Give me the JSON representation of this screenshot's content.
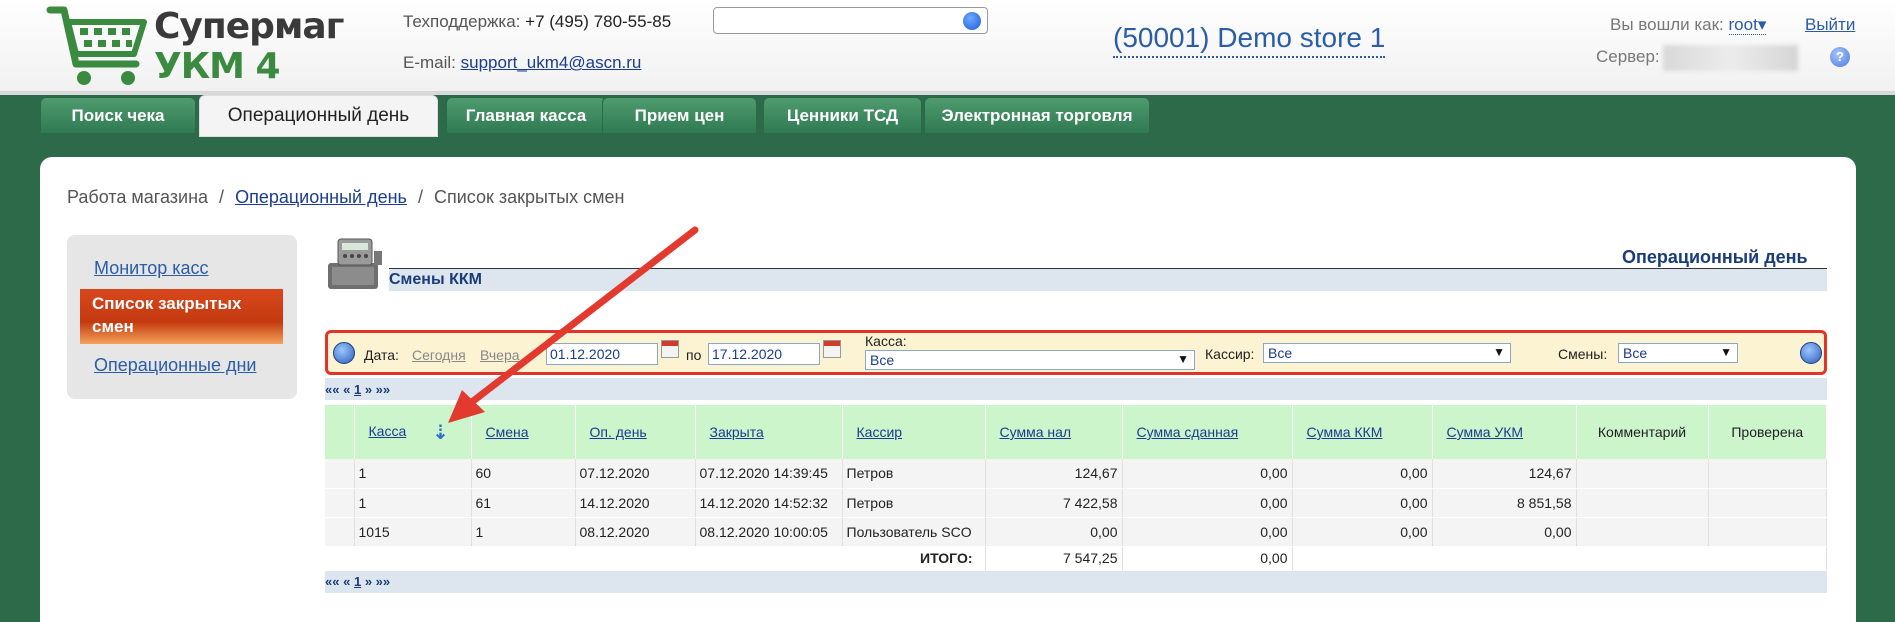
{
  "header": {
    "logo": {
      "line1": "Супермаг",
      "line2": "УКМ 4"
    },
    "support_label": "Техподдержка:",
    "support_phone": "+7 (495) 780-55-85",
    "email_label": "E-mail:",
    "email": "support_ukm4@ascn.ru",
    "search_placeholder": "",
    "store": "(50001) Demo store 1",
    "login_label": "Вы вошли как:",
    "user": "root",
    "logout": "Выйти",
    "server_label": "Сервер:",
    "help": "?"
  },
  "tabs": [
    {
      "label": "Поиск чека"
    },
    {
      "label": "Операционный день",
      "active": true
    },
    {
      "label": "Главная касса"
    },
    {
      "label": "Прием цен"
    },
    {
      "label": "Ценники ТСД"
    },
    {
      "label": "Электронная торговля"
    }
  ],
  "breadcrumb": {
    "root": "Работа магазина",
    "sep": "/",
    "parent": "Операционный день",
    "current": "Список закрытых смен"
  },
  "sidebar": {
    "items": [
      {
        "label": "Монитор касс"
      },
      {
        "label": "Список закрытых смен",
        "active": true
      },
      {
        "label": "Операционные дни"
      }
    ]
  },
  "content": {
    "section_title": "Операционный день",
    "subtitle": "Смены ККМ"
  },
  "filter": {
    "date_label": "Дата:",
    "today": "Сегодня",
    "yesterday": "Вчера",
    "date_from": "01.12.2020",
    "to_label": "по",
    "date_to": "17.12.2020",
    "kassa_label": "Касса:",
    "kassa_value": "Все",
    "cashier_label": "Кассир:",
    "cashier_value": "Все",
    "shifts_label": "Смены:",
    "shifts_value": "Все"
  },
  "pager": {
    "first": "««",
    "prev": "«",
    "page": "1",
    "next": "»",
    "last": "»»"
  },
  "table": {
    "columns": [
      "Касса",
      "Смена",
      "Оп. день",
      "Закрыта",
      "Кассир",
      "Сумма нал",
      "Сумма сданная",
      "Сумма ККМ",
      "Сумма УКМ",
      "Комментарий",
      "Проверена"
    ],
    "rows": [
      [
        "1",
        "60",
        "07.12.2020",
        "07.12.2020 14:39:45",
        "Петров",
        "124,67",
        "0,00",
        "0,00",
        "124,67",
        "",
        ""
      ],
      [
        "1",
        "61",
        "14.12.2020",
        "14.12.2020 14:52:32",
        "Петров",
        "7 422,58",
        "0,00",
        "0,00",
        "8 851,58",
        "",
        ""
      ],
      [
        "1015",
        "1",
        "08.12.2020",
        "08.12.2020 10:00:05",
        "Пользователь SCO",
        "0,00",
        "0,00",
        "0,00",
        "0,00",
        "",
        ""
      ]
    ],
    "total_label": "ИТОГО:",
    "total_cash": "7 547,25",
    "total_handed": "0,00"
  },
  "colors": {
    "brand_green": "#2c6a49",
    "accent_red": "#e0332a",
    "link": "#1a3c91"
  }
}
